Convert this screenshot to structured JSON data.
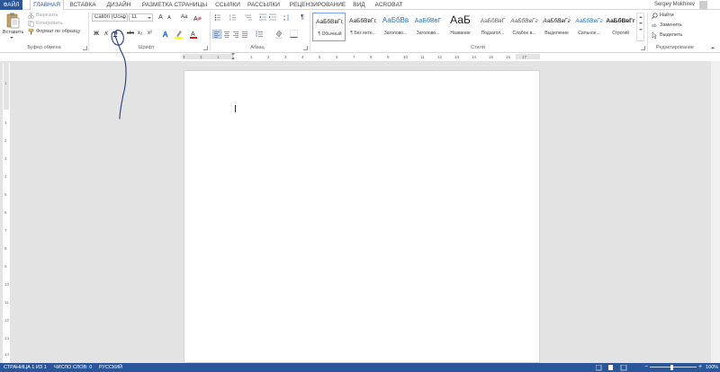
{
  "tabs": [
    {
      "label": "ФАЙЛ"
    },
    {
      "label": "ГЛАВНАЯ"
    },
    {
      "label": "ВСТАВКА"
    },
    {
      "label": "ДИЗАЙН"
    },
    {
      "label": "РАЗМЕТКА СТРАНИЦЫ"
    },
    {
      "label": "ССЫЛКИ"
    },
    {
      "label": "РАССЫЛКИ"
    },
    {
      "label": "РЕЦЕНЗИРОВАНИЕ"
    },
    {
      "label": "ВИД"
    },
    {
      "label": "ACROBAT"
    }
  ],
  "user_name": "Sergey Mokhirev",
  "clipboard": {
    "paste_label": "Вставить",
    "cut_label": "Вырезать",
    "copy_label": "Копировать",
    "format_painter_label": "Формат по образцу",
    "group_label": "Буфер обмена"
  },
  "font": {
    "font_name": "Calibri (Осно",
    "font_size": "11",
    "bold": "Ж",
    "italic": "К",
    "underline": "Ч",
    "strike": "abc",
    "subscript": "x₂",
    "superscript": "x²",
    "grow": "A",
    "shrink": "A",
    "case": "Aa",
    "group_label": "Шрифт"
  },
  "paragraph": {
    "pilcrow": "¶",
    "group_label": "Абзац"
  },
  "styles": {
    "items": [
      {
        "sample": "АаБбВвГг,",
        "name": "¶ Обычный"
      },
      {
        "sample": "АаБбВвГг,",
        "name": "¶ Без инте..."
      },
      {
        "sample": "АаБбВв",
        "name": "Заголово..."
      },
      {
        "sample": "АаБбВвГ",
        "name": "Заголово..."
      },
      {
        "sample": "АаБ",
        "name": "Название"
      },
      {
        "sample": "АаБбВвГ",
        "name": "Подзагол..."
      },
      {
        "sample": "АаБбВвГг",
        "name": "Слабое в..."
      },
      {
        "sample": "АаБбВвГг",
        "name": "Выделение"
      },
      {
        "sample": "АаБбВвГг",
        "name": "Сильное..."
      },
      {
        "sample": "АаБбВвГг",
        "name": "Строгий"
      }
    ],
    "group_label": "Стили"
  },
  "editing": {
    "find_label": "Найти",
    "replace_label": "Заменить",
    "select_label": "Выделить",
    "group_label": "Редактирование"
  },
  "ruler": {
    "numbers": [
      "3",
      "2",
      "1",
      "1",
      "2",
      "3",
      "4",
      "5",
      "6",
      "7",
      "8",
      "9",
      "10",
      "11",
      "12",
      "13",
      "14",
      "15",
      "16",
      "17"
    ]
  },
  "vruler": {
    "numbers": [
      "1",
      "1",
      "2",
      "3",
      "4",
      "5",
      "6",
      "7",
      "8",
      "9",
      "10",
      "11",
      "12",
      "13",
      "14"
    ]
  },
  "status": {
    "page": "СТРАНИЦА 1 ИЗ 1",
    "words": "ЧИСЛО СЛОВ: 0",
    "language": "РУССКИЙ",
    "zoom": "100%"
  },
  "colors": {
    "accent": "#2b579a",
    "annotation_pen": "#1f3b8c"
  }
}
